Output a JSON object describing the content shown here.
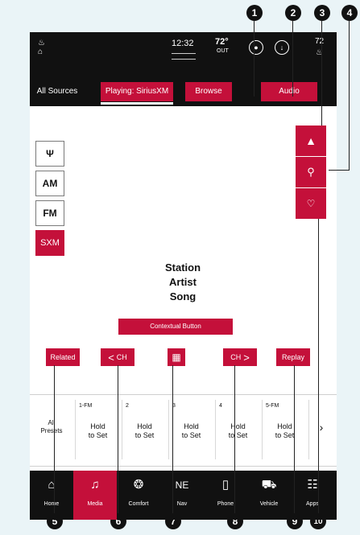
{
  "status": {
    "left_icons": "72 ° seat",
    "time": "12:32",
    "temp_value": "72°",
    "temp_label": "OUT",
    "right_temp": "72"
  },
  "sources": {
    "all": "All Sources",
    "playing": "Playing: SiriusXM",
    "browse": "Browse",
    "audio": "Audio"
  },
  "bands": [
    "Ψ",
    "AM",
    "FM",
    "SXM"
  ],
  "now_playing": {
    "station": "Station",
    "artist": "Artist",
    "song": "Song"
  },
  "contextual_button": "Contextual Button",
  "controls": {
    "related": "Related",
    "ch_prev": "CH",
    "ch_next": "CH",
    "replay": "Replay"
  },
  "presets": {
    "all_label_line1": "All",
    "all_label_line2": "Presets",
    "items": [
      {
        "num": "1-FM",
        "hold1": "Hold",
        "hold2": "to Set"
      },
      {
        "num": "2",
        "hold1": "Hold",
        "hold2": "to Set"
      },
      {
        "num": "3",
        "hold1": "Hold",
        "hold2": "to Set"
      },
      {
        "num": "4",
        "hold1": "Hold",
        "hold2": "to Set"
      },
      {
        "num": "5-FM",
        "hold1": "Hold",
        "hold2": "to Set"
      }
    ],
    "more": "›"
  },
  "nav": [
    {
      "icon": "⌂",
      "label": "Home"
    },
    {
      "icon": "♫",
      "label": "Media"
    },
    {
      "icon": "❂",
      "label": "Comfort"
    },
    {
      "icon": "NE",
      "label": "Nav"
    },
    {
      "icon": "▯",
      "label": "Phone"
    },
    {
      "icon": "⛟",
      "label": "Vehicle"
    },
    {
      "icon": "☷",
      "label": "Apps"
    }
  ],
  "callouts": [
    "1",
    "2",
    "3",
    "4",
    "5",
    "6",
    "7",
    "8",
    "9",
    "10"
  ],
  "colors": {
    "accent": "#c4103a",
    "bar": "#111111",
    "page_bg": "#eaf4f7"
  }
}
